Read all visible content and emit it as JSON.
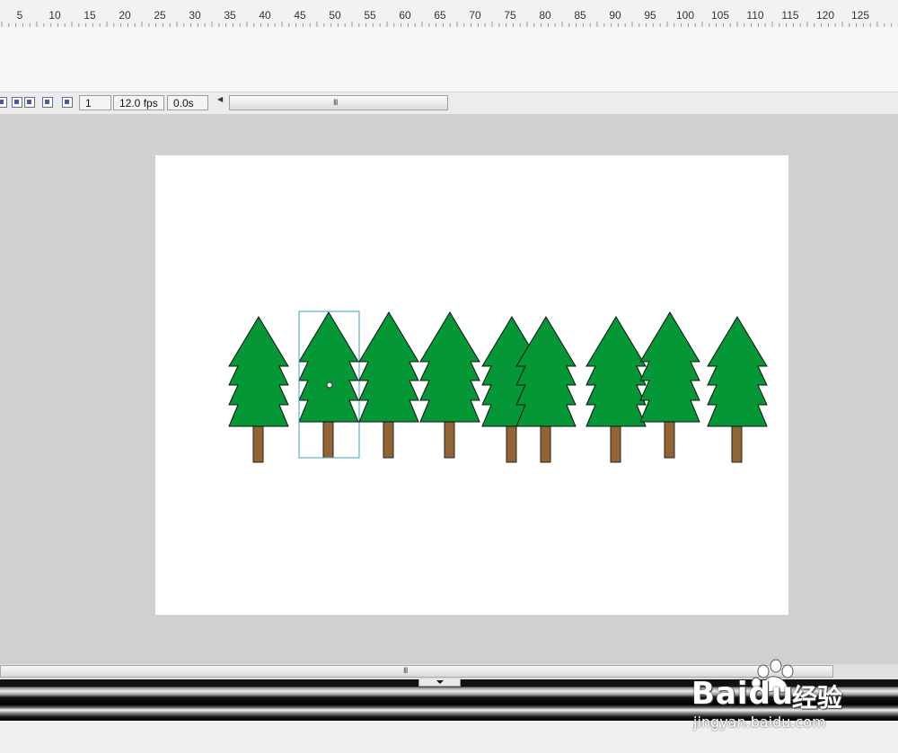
{
  "ruler": {
    "labels": [
      "5",
      "10",
      "15",
      "20",
      "25",
      "30",
      "35",
      "40",
      "45",
      "50",
      "55",
      "60",
      "65",
      "70",
      "75",
      "80",
      "85",
      "90",
      "95",
      "100",
      "105",
      "110",
      "115",
      "120",
      "125"
    ]
  },
  "status": {
    "frame": "1",
    "fps": "12.0 fps",
    "time": "0.0s",
    "scroll_grip": "III"
  },
  "stage": {
    "tree_count": 9,
    "selected_tree": 2
  },
  "bottom": {
    "scroll_grip": "III"
  },
  "watermark": {
    "brand": "Bai",
    "brand_suffix": "du",
    "cn": "经验",
    "url": "jingyan.baidu.com"
  },
  "colors": {
    "tree_green": "#049735",
    "trunk_brown": "#936433",
    "selection": "#3aa3c3"
  }
}
